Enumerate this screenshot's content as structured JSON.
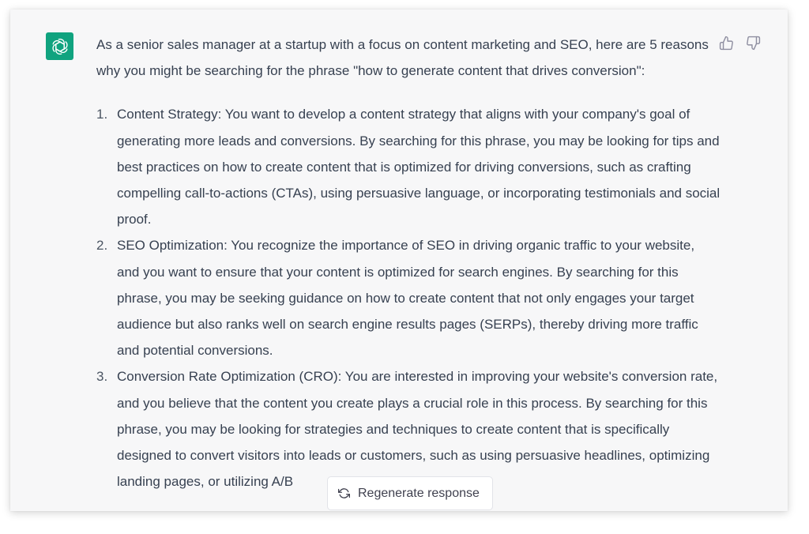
{
  "message": {
    "intro": "As a senior sales manager at a startup with a focus on content marketing and SEO, here are 5 reasons why you might be searching for the phrase \"how to generate content that drives conversion\":",
    "items": [
      {
        "number": "1.",
        "text": "Content Strategy: You want to develop a content strategy that aligns with your company's goal of generating more leads and conversions. By searching for this phrase, you may be looking for tips and best practices on how to create content that is optimized for driving conversions, such as crafting compelling call-to-actions (CTAs), using persuasive language, or incorporating testimonials and social proof."
      },
      {
        "number": "2.",
        "text": "SEO Optimization: You recognize the importance of SEO in driving organic traffic to your website, and you want to ensure that your content is optimized for search engines. By searching for this phrase, you may be seeking guidance on how to create content that not only engages your target audience but also ranks well on search engine results pages (SERPs), thereby driving more traffic and potential conversions."
      },
      {
        "number": "3.",
        "text": "Conversion Rate Optimization (CRO): You are interested in improving your website's conversion rate, and you believe that the content you create plays a crucial role in this process. By searching for this phrase, you may be looking for strategies and techniques to create content that is specifically designed to convert visitors into leads or customers, such as using persuasive headlines, optimizing landing pages, or utilizing A/B"
      }
    ]
  },
  "controls": {
    "regenerate_label": "Regenerate response",
    "thumbs_up_icon": "thumbs-up-icon",
    "thumbs_down_icon": "thumbs-down-icon",
    "regenerate_icon": "refresh-icon",
    "avatar_icon": "openai-logo-icon"
  },
  "colors": {
    "avatar_bg": "#10a37f",
    "message_bg": "#f7f7f8",
    "text": "#374151"
  }
}
